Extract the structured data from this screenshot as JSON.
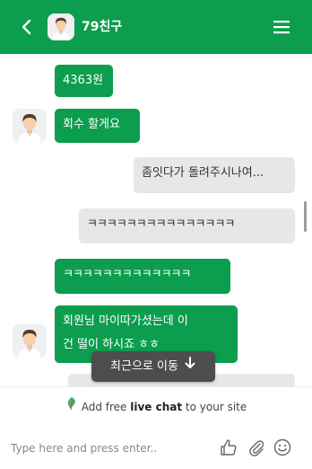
{
  "header": {
    "title": "79친구",
    "back_icon": "chevron-left-icon",
    "menu_icon": "hamburger-menu-icon"
  },
  "messages": [
    {
      "side": "agent",
      "text": "4363원"
    },
    {
      "side": "agent",
      "text": "회수 할게요"
    },
    {
      "side": "visitor",
      "text": "좀잇다가 돌려주시나여..."
    },
    {
      "side": "visitor",
      "text": "ㅋㅋㅋㅋㅋㅋㅋㅋㅋㅋㅋㅋㅋㅋㅋ"
    },
    {
      "side": "agent",
      "text": "ㅋㅋㅋㅋㅋㅋㅋㅋㅋㅋㅋㅋㅋ"
    },
    {
      "side": "agent",
      "text": "회원님 마이따가셨는데 이\n건 떨이 하시죠 ㅎㅎ"
    }
  ],
  "scroll_to_recent": {
    "label": "최근으로 이동"
  },
  "promo": {
    "prefix": "Add free ",
    "bold": "live chat",
    "suffix": " to your site"
  },
  "composer": {
    "placeholder": "Type here and press enter..",
    "icons": [
      "thumbs-up-icon",
      "paperclip-icon",
      "emoji-icon"
    ]
  },
  "colors": {
    "brand": "#0c9d4e",
    "visitor_bubble": "#e6e7e9",
    "toast": "#4d4d4d"
  }
}
